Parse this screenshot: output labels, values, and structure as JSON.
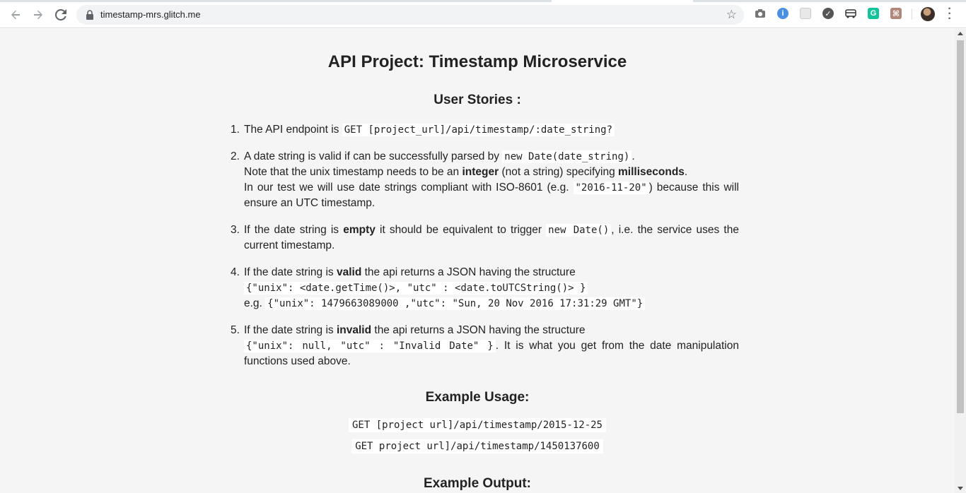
{
  "browser": {
    "url": "timestamp-mrs.glitch.me",
    "colors": {
      "chrome_bg": "#ffffff",
      "omnibox_bg": "#f1f3f4",
      "page_bg": "#f5f5f5"
    },
    "icons": [
      "back-arrow-icon",
      "forward-arrow-icon",
      "reload-icon",
      "lock-icon",
      "bookmark-star-icon",
      "camera-extension-icon",
      "info-extension-icon",
      "grid-extension-icon",
      "feather-extension-icon",
      "bus-extension-icon",
      "grammarly-extension-icon",
      "pdf-extension-icon",
      "profile-avatar",
      "chrome-menu-icon"
    ]
  },
  "page": {
    "title": "API Project: Timestamp Microservice",
    "stories_heading": "User Stories :",
    "stories": [
      {
        "num": "1.",
        "t1": "The API endpoint is ",
        "c1": "GET [project_url]/api/timestamp/:date_string?"
      },
      {
        "num": "2.",
        "t1": "A date string is valid if can be successfully parsed by ",
        "c1": "new Date(date_string)",
        "t2": ".",
        "t3": "Note that the unix timestamp needs to be an ",
        "b1": "integer",
        "t4": " (not a string) specifying ",
        "b2": "milliseconds",
        "t5": ".",
        "t6": "In our test we will use date strings compliant with ISO-8601 (e.g. ",
        "c2": "\"2016-11-20\"",
        "t7": ") because this will ensure an UTC timestamp."
      },
      {
        "num": "3.",
        "t1": "If the date string is ",
        "b1": "empty",
        "t2": " it should be equivalent to trigger ",
        "c1": "new Date()",
        "t3": ", i.e. the service uses the current timestamp."
      },
      {
        "num": "4.",
        "t1": "If the date string is ",
        "b1": "valid",
        "t2": " the api returns a JSON having the structure",
        "c1": "{\"unix\": <date.getTime()>, \"utc\" : <date.toUTCString()> }",
        "t3": "e.g. ",
        "c2": "{\"unix\": 1479663089000 ,\"utc\": \"Sun, 20 Nov 2016 17:31:29 GMT\"}"
      },
      {
        "num": "5.",
        "t1": "If the date string is ",
        "b1": "invalid",
        "t2": " the api returns a JSON having the structure",
        "c1": "{\"unix\": null, \"utc\" : \"Invalid Date\" }",
        "t3": ". It is what you get from the date manipulation functions used above."
      }
    ],
    "usage_heading": "Example Usage:",
    "usage": [
      "GET [project url]/api/timestamp/2015-12-25",
      "GET project url]/api/timestamp/1450137600"
    ],
    "output_heading": "Example Output:"
  }
}
